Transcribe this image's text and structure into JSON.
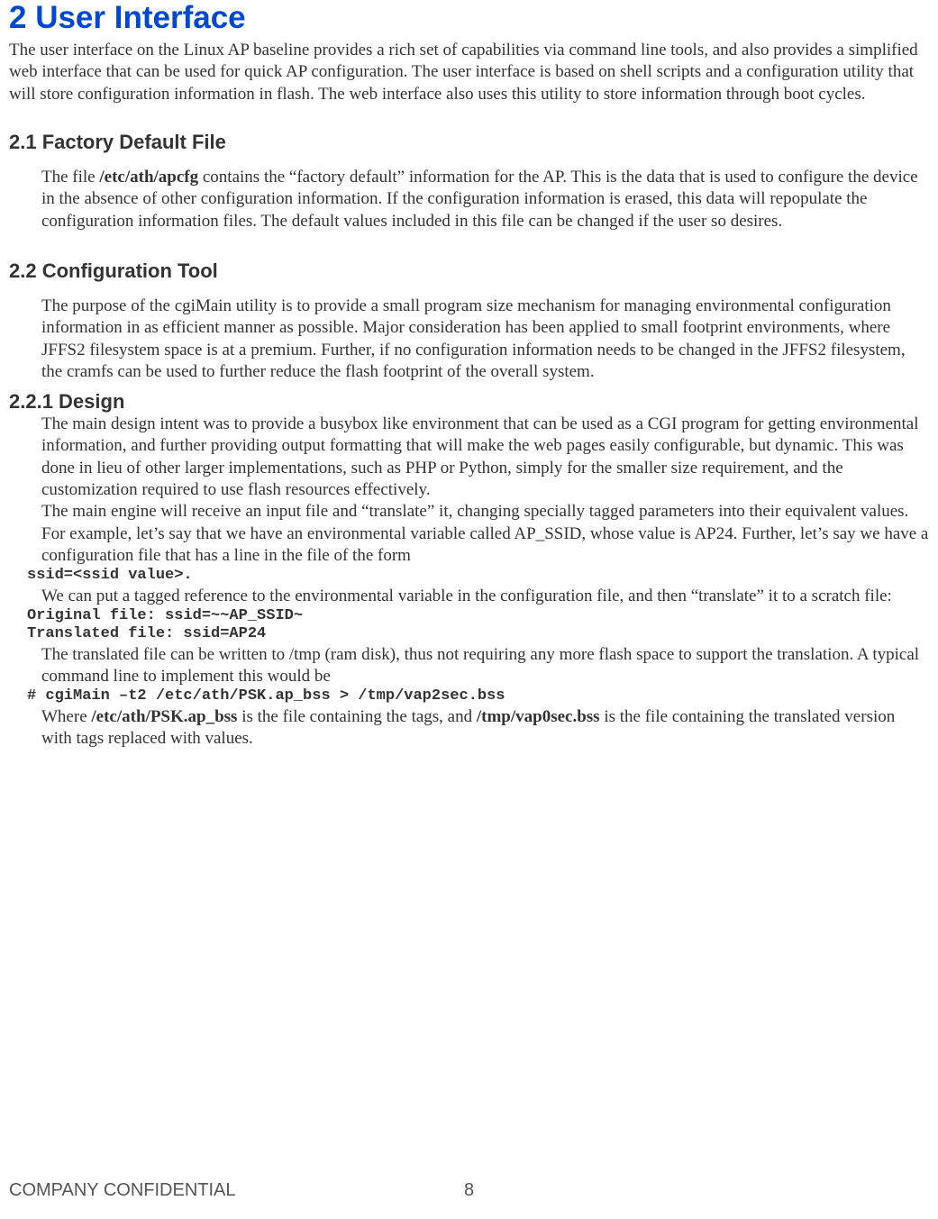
{
  "h1": "2 User Interface",
  "intro": "The user interface on the Linux AP baseline provides a rich set of capabilities via command line tools, and also provides a simplified web interface that can be used for quick AP configuration. The user interface is based on shell scripts and a configuration utility that will store configuration information in flash. The web interface also uses this utility to store information through boot cycles.",
  "sec21_title": "2.1 Factory Default File",
  "sec21_text_a": "The file ",
  "sec21_bold": "/etc/ath/apcfg",
  "sec21_text_b": " contains the “factory default” information for the AP. This is the data that is used to configure the device in the absence of other configuration information. If the configuration information is erased, this data will repopulate the configuration information files. The default values included in this file can be changed if the user so desires.",
  "sec22_title": "2.2 Configuration Tool",
  "sec22_intro": "The purpose of the cgiMain utility is to provide a small program size mechanism for managing environmental configuration information in as efficient manner as possible. Major consideration has been applied to small footprint environments, where JFFS2 filesystem space is at a premium. Further, if no configuration information needs to be changed in the JFFS2 filesystem, the cramfs can be used to further reduce the flash footprint of the overall system.",
  "sec221_title": "2.2.1 Design",
  "sec221_para1": "The main design intent was to provide a busybox like environment that can be used as a CGI program for getting environmental information, and further providing output formatting that will make the web pages easily configurable, but dynamic. This was done in lieu of other larger implementations, such as PHP or Python, simply for the smaller size requirement, and the customization required to use flash resources effectively.",
  "sec221_para2": "The main engine will receive an input file and “translate” it, changing specially tagged parameters into their equivalent values. For example, let’s say that we have an environmental variable called AP_SSID, whose value is AP24. Further, let’s say we have a configuration file that has a line in the file of the form",
  "code1": "ssid=<ssid value>.",
  "sec221_para3": "We can put a tagged reference to the environmental variable in the configuration file, and then “translate” it to a scratch file:",
  "code2": "Original file: ssid=~~AP_SSID~\nTranslated file: ssid=AP24",
  "sec221_para4": "The translated file can be written to /tmp (ram disk), thus not requiring any more flash space to support the translation. A typical command line to implement this would be",
  "code3": "# cgiMain –t2 /etc/ath/PSK.ap_bss > /tmp/vap2sec.bss",
  "sec221_para5_a": "Where ",
  "sec221_bold1": "/etc/ath/PSK.ap_bss",
  "sec221_para5_b": " is the file containing the tags, and ",
  "sec221_bold2": "/tmp/vap0sec.bss",
  "sec221_para5_c": " is the file containing the translated version with tags replaced with values.",
  "footer_left": "COMPANY CONFIDENTIAL",
  "footer_center": "8"
}
